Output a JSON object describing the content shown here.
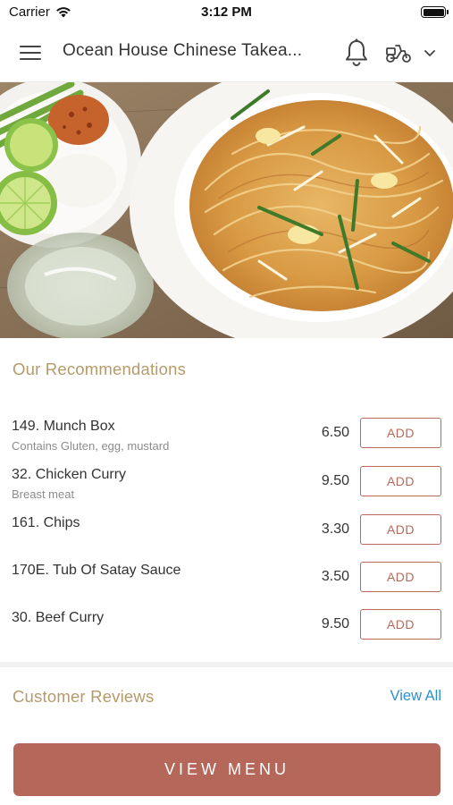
{
  "status_bar": {
    "carrier": "Carrier",
    "time": "3:12 PM",
    "icons": [
      "wifi-icon",
      "battery-icon"
    ]
  },
  "nav": {
    "title": "Ocean House Chinese Takea...",
    "icons": [
      "hamburger-menu-icon",
      "bell-icon",
      "scooter-icon",
      "chevron-down-icon"
    ]
  },
  "hero": {
    "image": "plate of pad thai noodles with limes, chili flakes and a glass of water"
  },
  "recommendations": {
    "title": "Our Recommendations",
    "items": [
      {
        "name": "149. Munch Box",
        "description": "Contains Gluten, egg, mustard",
        "price": "6.50",
        "button": "ADD"
      },
      {
        "name": "32. Chicken Curry",
        "description": "Breast meat",
        "price": "9.50",
        "button": "ADD"
      },
      {
        "name": "161. Chips",
        "description": "",
        "price": "3.30",
        "button": "ADD"
      },
      {
        "name": "170E. Tub Of Satay Sauce",
        "description": "",
        "price": "3.50",
        "button": "ADD"
      },
      {
        "name": "30. Beef Curry",
        "description": "",
        "price": "9.50",
        "button": "ADD"
      }
    ]
  },
  "reviews": {
    "title": "Customer Reviews",
    "view_all": "View All"
  },
  "footer": {
    "view_menu": "VIEW MENU"
  },
  "colors": {
    "accent": "#b5675a",
    "section_title": "#b59a6a",
    "link": "#2f8fcf"
  }
}
